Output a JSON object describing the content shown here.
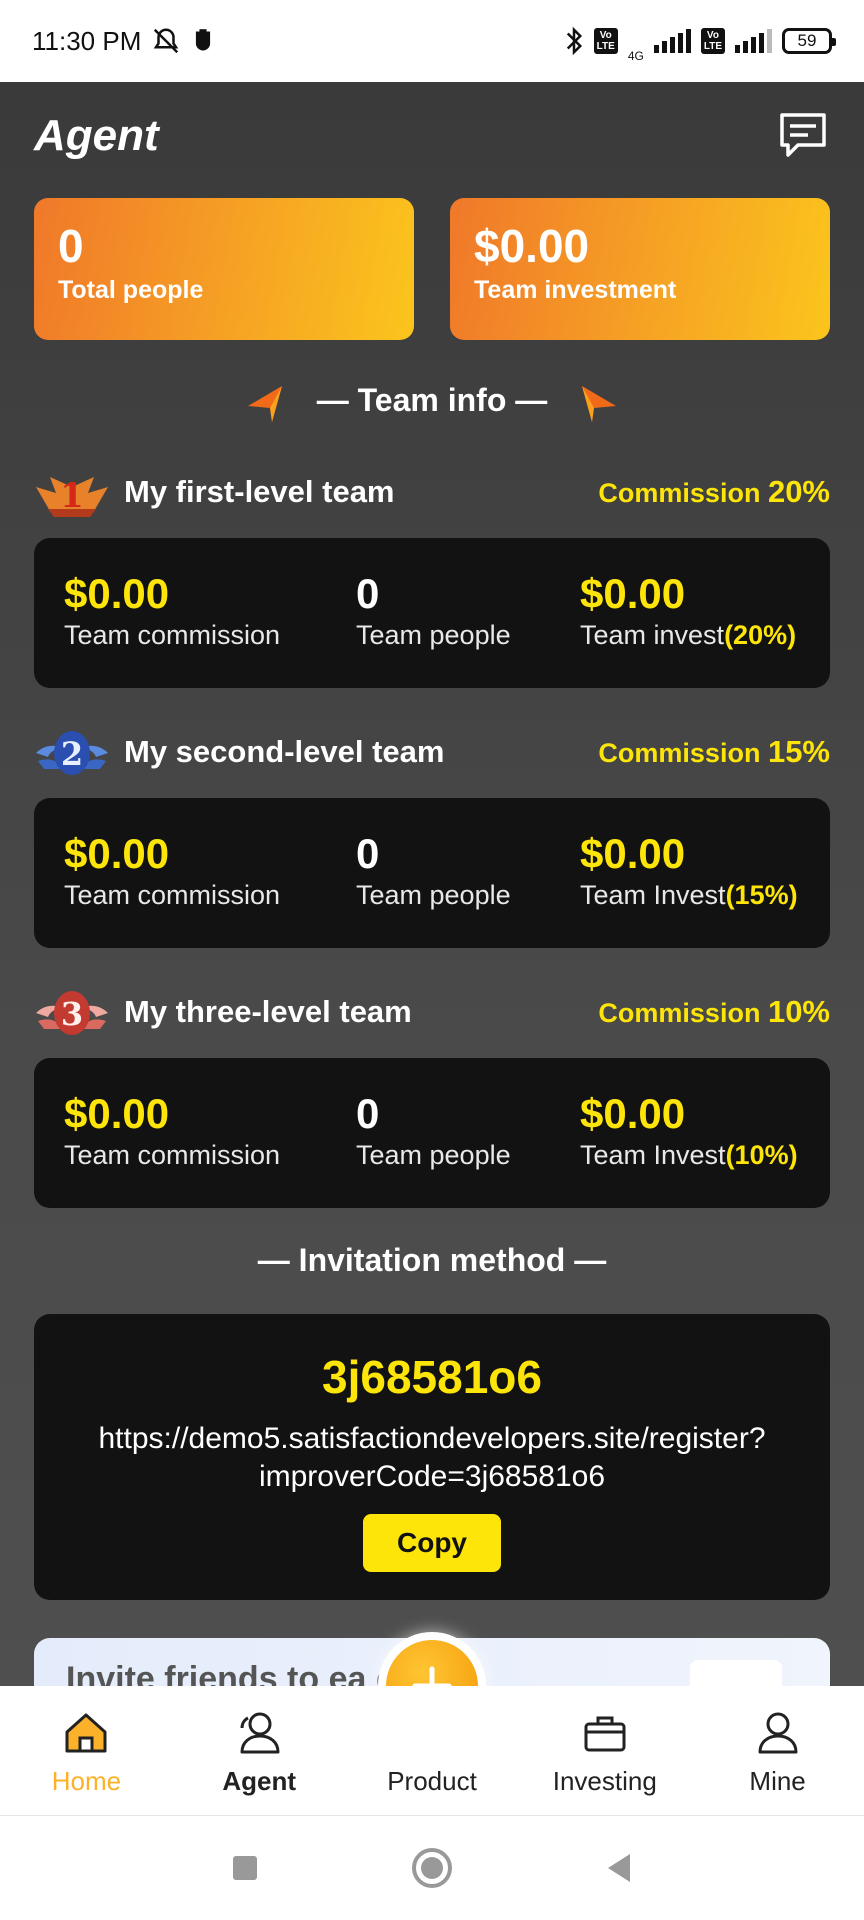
{
  "status_bar": {
    "time": "11:30 PM",
    "network": "4G",
    "volte": "Vo LTE",
    "battery": "59"
  },
  "header": {
    "title": "Agent"
  },
  "stats": {
    "total_people_value": "0",
    "total_people_label": "Total people",
    "team_investment_value": "$0.00",
    "team_investment_label": "Team investment"
  },
  "team_info": {
    "title": "— Team info —"
  },
  "levels": [
    {
      "name": "My first-level team",
      "commission_label": "Commission",
      "commission_pct": "20%",
      "badge_number": "1",
      "commission_value": "$0.00",
      "commission_caption": "Team commission",
      "people_value": "0",
      "people_caption": "Team people",
      "invest_value": "$0.00",
      "invest_caption": "Team invest",
      "invest_pct": "(20%)"
    },
    {
      "name": "My second-level team",
      "commission_label": "Commission",
      "commission_pct": "15%",
      "badge_number": "2",
      "commission_value": "$0.00",
      "commission_caption": "Team commission",
      "people_value": "0",
      "people_caption": "Team people",
      "invest_value": "$0.00",
      "invest_caption": "Team Invest",
      "invest_pct": "(15%)"
    },
    {
      "name": "My three-level team",
      "commission_label": "Commission",
      "commission_pct": "10%",
      "badge_number": "3",
      "commission_value": "$0.00",
      "commission_caption": "Team commission",
      "people_value": "0",
      "people_caption": "Team people",
      "invest_value": "$0.00",
      "invest_caption": "Team Invest",
      "invest_pct": "(10%)"
    }
  ],
  "invitation": {
    "title": "— Invitation method —",
    "code": "3j68581o6",
    "link_line1": "https://demo5.satisfactiondevelopers.site/register?",
    "link_line2": "improverCode=3j68581o6",
    "copy_label": "Copy"
  },
  "banner": {
    "text": "Invite friends to ea    ey"
  },
  "bottom_nav": {
    "items": [
      {
        "label": "Home",
        "icon": "home-icon"
      },
      {
        "label": "Agent",
        "icon": "agent-icon"
      },
      {
        "label": "Product",
        "icon": "plus-icon"
      },
      {
        "label": "Investing",
        "icon": "briefcase-icon"
      },
      {
        "label": "Mine",
        "icon": "user-icon"
      }
    ]
  },
  "colors": {
    "accent_yellow": "#fde50a",
    "active_nav": "#fbb22a",
    "card_gradient_start": "#f0782a",
    "card_gradient_end": "#fbc51c",
    "card_dark": "#121212"
  }
}
